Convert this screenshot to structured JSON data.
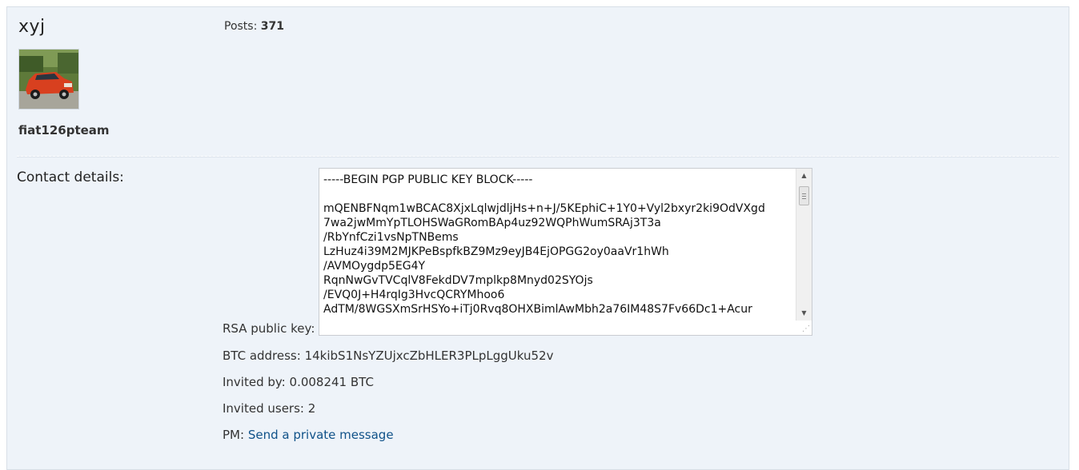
{
  "profile": {
    "username": "xyj",
    "rank": "fiat126pteam",
    "posts_label": "Posts:",
    "posts_count": "371"
  },
  "contact": {
    "title": "Contact details:",
    "rsa_label": "RSA public key:",
    "rsa_key": "-----BEGIN PGP PUBLIC KEY BLOCK-----\n\nmQENBFNqm1wBCAC8XjxLqlwjdljHs+n+J/5KEphiC+1Y0+Vyl2bxyr2ki9OdVXgd\n7wa2jwMmYpTLOHSWaGRomBAp4uz92WQPhWumSRAj3T3a\n/RbYnfCzi1vsNpTNBems\nLzHuz4i39M2MJKPeBspfkBZ9Mz9eyJB4EjOPGG2oy0aaVr1hWh\n/AVMOygdp5EG4Y\nRqnNwGvTVCqlV8FekdDV7mplkp8Mnyd02SYOjs\n/EVQ0J+H4rqIg3HvcQCRYMhoo6\nAdTM/8WGSXmSrHSYo+iTj0Rvq8OHXBimlAwMbh2a76IM48S7Fv66Dc1+Acur",
    "btc_label": "BTC address:",
    "btc_value": "14kibS1NsYZUjxcZbHLER3PLpLggUku52v",
    "invited_by_label": "Invited by:",
    "invited_by_value": "0.008241 BTC",
    "invited_users_label": "Invited users:",
    "invited_users_value": "2",
    "pm_label": "PM:",
    "pm_link": "Send a private message"
  },
  "icons": {
    "scroll_up": "arrow-up-icon",
    "scroll_down": "arrow-down-icon",
    "resize": "resize-grip-icon"
  },
  "colors": {
    "panel_bg": "#eef3f9",
    "link": "#105289",
    "avatar_car": "#d8401f"
  }
}
